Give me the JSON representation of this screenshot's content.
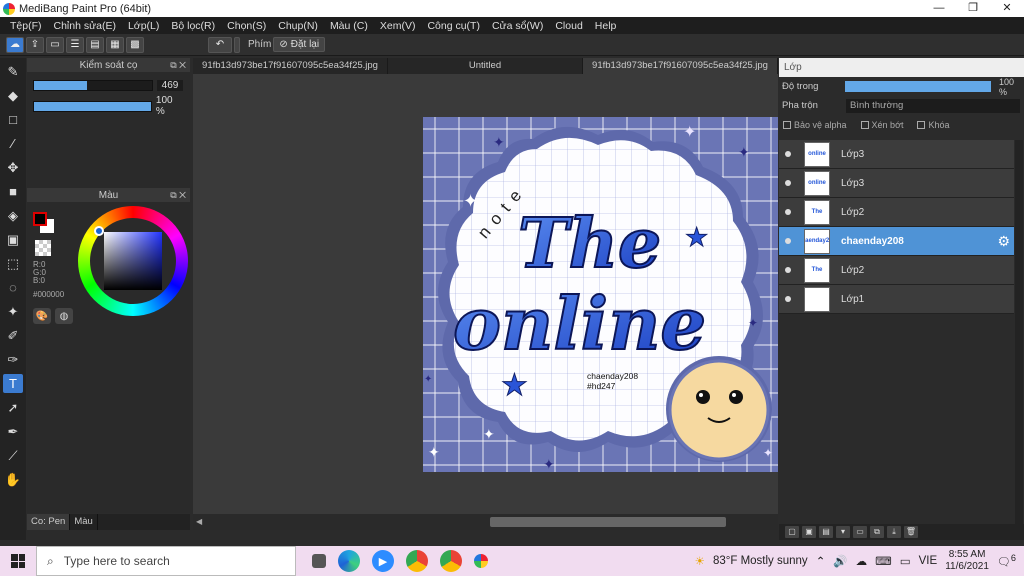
{
  "window": {
    "title": "MediBang Paint Pro (64bit)",
    "minimize": "—",
    "maximize": "❐",
    "close": "✕"
  },
  "menu": [
    "Tệp(F)",
    "Chỉnh sửa(E)",
    "Lớp(L)",
    "Bộ lọc(R)",
    "Chọn(S)",
    "Chụp(N)",
    "Màu (C)",
    "Xem(V)",
    "Công cụ(T)",
    "Cửa sổ(W)",
    "Cloud",
    "Help"
  ],
  "toolbar": {
    "key_label": "Phím",
    "reset_label": "Đặt lại"
  },
  "brush_panel": {
    "title": "Kiểm soát cọ",
    "size": "469",
    "opacity": "100 %",
    "size_fraction": 0.45,
    "opacity_fraction": 1.0
  },
  "color_panel": {
    "title": "Màu",
    "r": "R:0",
    "g": "G:0",
    "b": "B:0",
    "hex": "#000000",
    "fg_color": "#000000",
    "bg_color": "#ffffff"
  },
  "bottom_tabs": [
    "Co: Pen",
    "Màu"
  ],
  "doc_tabs": [
    "91fb13d973be17f91607095c5ea34f25.jpg",
    "Untitled",
    "91fb13d973be17f91607095c5ea34f25.jpg"
  ],
  "canvas": {
    "signature": "chaenday208",
    "hashtag": "#hd247",
    "word_note": "note",
    "word_the": "The",
    "word_online": "online"
  },
  "layer_panel": {
    "title": "Lớp",
    "opacity_label": "Độ trong",
    "opacity_value": "100 %",
    "opacity_fraction": 1.0,
    "blend_label": "Pha trộn",
    "blend_value": "Bình thường",
    "protect_alpha": "Bảo vệ alpha",
    "clipping": "Xén bớt",
    "lock": "Khóa",
    "layers": [
      {
        "name": "Lớp3",
        "thumb": "online",
        "active": false
      },
      {
        "name": "Lớp3",
        "thumb": "online",
        "active": false
      },
      {
        "name": "Lớp2",
        "thumb": "The",
        "active": false
      },
      {
        "name": "chaenday208",
        "thumb": "chaenday208",
        "active": true
      },
      {
        "name": "Lớp2",
        "thumb": "The",
        "active": false
      },
      {
        "name": "Lớp1",
        "thumb": "",
        "active": false
      }
    ]
  },
  "taskbar": {
    "search_placeholder": "Type here to search",
    "weather": "83°F  Mostly sunny",
    "lang": "VIE",
    "time": "8:55 AM",
    "date": "11/6/2021",
    "notifications": "6"
  }
}
